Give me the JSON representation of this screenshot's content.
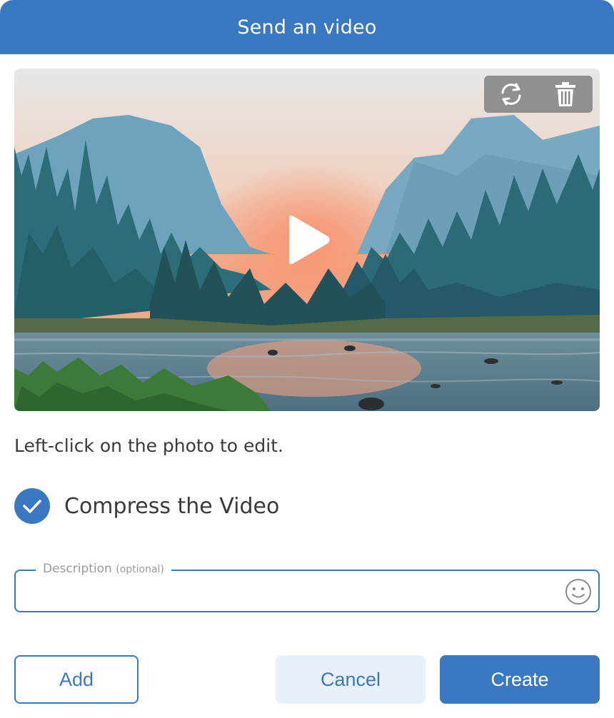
{
  "dialog": {
    "title": "Send an video"
  },
  "media": {
    "tools": [
      {
        "name": "replace",
        "icon": "refresh-icon"
      },
      {
        "name": "delete",
        "icon": "trash-icon"
      }
    ],
    "play_icon": "play-icon"
  },
  "hint": "Left-click on the photo to edit.",
  "compress": {
    "label": "Compress the Video",
    "checked": true
  },
  "description": {
    "label": "Description",
    "optional": "(optional)",
    "value": "",
    "emoji_icon": "smiley-icon"
  },
  "buttons": {
    "add": "Add",
    "cancel": "Cancel",
    "create": "Create"
  },
  "colors": {
    "accent": "#3a78c2",
    "cancel_bg": "#e8f0fa",
    "tool_bg": "#787878"
  }
}
